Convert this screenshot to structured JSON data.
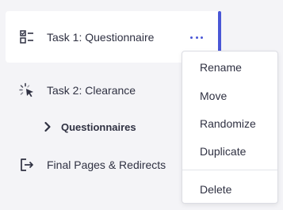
{
  "nav": {
    "task1": {
      "label": "Task 1: Questionnaire",
      "icon": "checklist-icon",
      "active": true
    },
    "task2": {
      "label": "Task 2: Clearance",
      "icon": "loading-cursor-icon"
    },
    "questionnaires": {
      "label": "Questionnaires",
      "icon": "chevron-right-icon"
    },
    "final": {
      "label": "Final Pages & Redirects",
      "icon": "exit-icon"
    }
  },
  "menu": {
    "items": [
      {
        "label": "Rename"
      },
      {
        "label": "Move"
      },
      {
        "label": "Randomize"
      },
      {
        "label": "Duplicate"
      },
      {
        "label": "Delete"
      }
    ]
  },
  "colors": {
    "accent": "#4a57d6",
    "background": "#f4f4f7",
    "text": "#2f3142"
  }
}
